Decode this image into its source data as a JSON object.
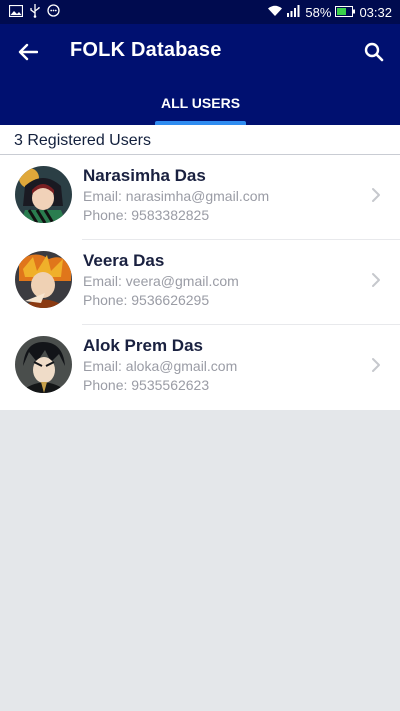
{
  "status_bar": {
    "battery_percent": "58%",
    "time": "03:32",
    "icons": [
      "image-icon",
      "usb-icon",
      "messenger-icon",
      "wifi-icon",
      "signal-icon",
      "battery-icon"
    ]
  },
  "app_bar": {
    "title": "FOLK Database",
    "back_icon": "arrow-left-icon",
    "search_icon": "search-icon"
  },
  "tabs": [
    {
      "label": "ALL USERS",
      "selected": true
    }
  ],
  "summary": {
    "registered_count_text": "3 Registered Users"
  },
  "users": [
    {
      "name": "Narasimha Das",
      "email": "Email: narasimha@gmail.com",
      "phone": "Phone: 9583382825",
      "avatar": "avatar-anime-character-1"
    },
    {
      "name": "Veera Das",
      "email": "Email: veera@gmail.com",
      "phone": "Phone: 9536626295",
      "avatar": "avatar-anime-character-2"
    },
    {
      "name": "Alok Prem Das",
      "email": "Email: aloka@gmail.com",
      "phone": "Phone: 9535562623",
      "avatar": "avatar-anime-character-3"
    }
  ],
  "colors": {
    "app_bar": "#001070",
    "status_bar": "#000b4f",
    "tab_indicator": "#2f8cf0",
    "background": "#e4e7ea",
    "name_text": "#1a2140",
    "secondary_text": "#9a9ca5"
  }
}
